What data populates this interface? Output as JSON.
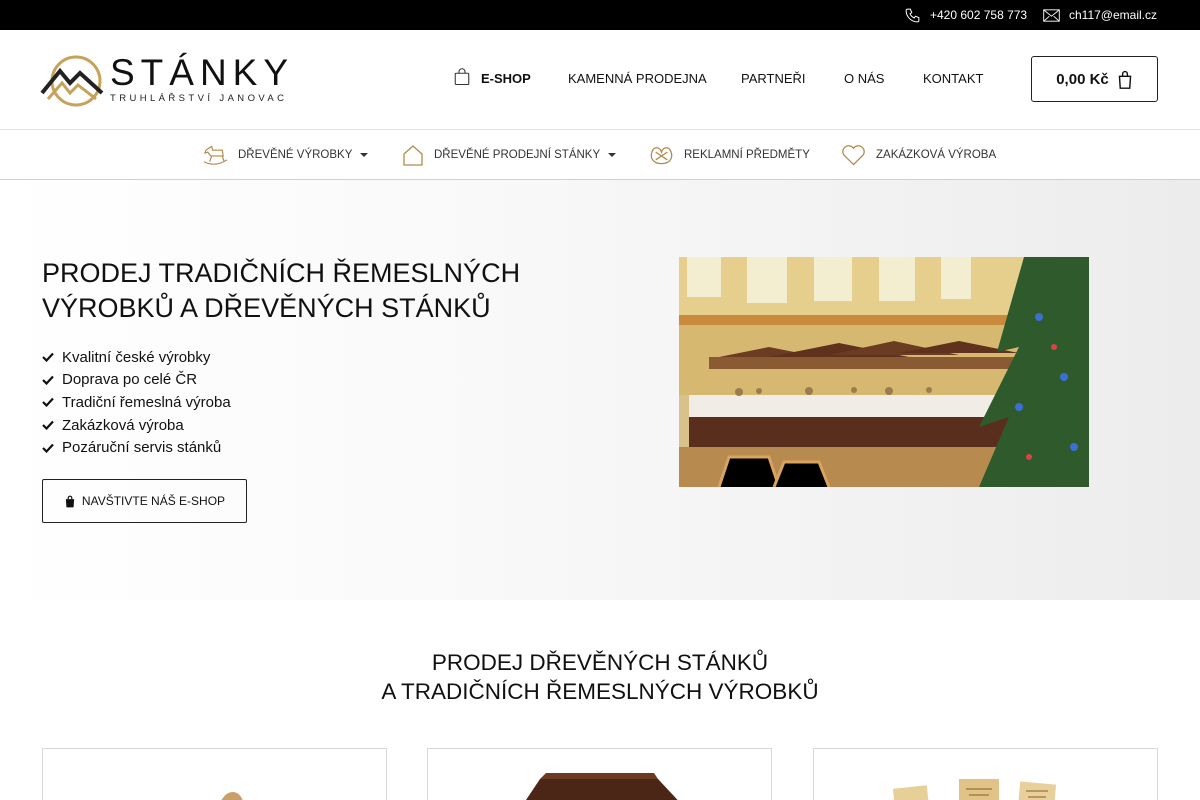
{
  "topbar": {
    "phone": "+420 602 758 773",
    "email": "ch117@email.cz",
    "phone_icon": "phone-icon",
    "email_icon": "envelope-icon"
  },
  "logo": {
    "wordmark": "STÁNKY",
    "tagline": "TRUHLÁŘSTVÍ JANOVAC",
    "colors": {
      "gold": "#c8a15a",
      "dark": "#222222"
    }
  },
  "main_nav": {
    "items": [
      {
        "label": "E-SHOP",
        "icon": "shopping-bag-icon"
      },
      {
        "label": "KAMENNÁ PRODEJNA"
      },
      {
        "label": "PARTNEŘI"
      },
      {
        "label": "O NÁS"
      },
      {
        "label": "KONTAKT"
      }
    ]
  },
  "cart": {
    "total": "0,00 Kč",
    "icon": "shopping-bag-icon"
  },
  "sub_nav": {
    "items": [
      {
        "label": "DŘEVĚNÉ VÝROBKY",
        "icon": "rocking-horse-icon",
        "has_dropdown": true
      },
      {
        "label": "DŘEVĚNÉ PRODEJNÍ STÁNKY",
        "icon": "house-icon",
        "has_dropdown": true
      },
      {
        "label": "REKLAMNÍ PŘEDMĚTY",
        "icon": "pretzel-icon",
        "has_dropdown": false
      },
      {
        "label": "ZAKÁZKOVÁ VÝROBA",
        "icon": "heart-icon",
        "has_dropdown": false
      }
    ]
  },
  "hero": {
    "title_line1": "PRODEJ TRADIČNÍCH ŘEMESLNÝCH",
    "title_line2": "VÝROBKŮ A DŘEVĚNÝCH STÁNKŮ",
    "features": [
      "Kvalitní české výrobky",
      "Doprava po celé ČR",
      "Tradiční řemeslná výroba",
      "Zakázková výroba",
      "Pozáruční servis stánků"
    ],
    "cta_label": "NAVŠTIVTE NÁŠ E-SHOP",
    "cta_icon": "shopping-bag-icon",
    "photo": "market-hall-with-wooden-stalls-and-christmas-tree-photo"
  },
  "section2": {
    "title_line1": "PRODEJ DŘEVĚNÝCH STÁNKŮ",
    "title_line2": "A TRADIČNÍCH ŘEMESLNÝCH VÝROBKŮ",
    "cards": [
      {
        "image": "wooden-toy-product-photo"
      },
      {
        "image": "wooden-market-stall-product-photo"
      },
      {
        "image": "engraved-wooden-boards-product-photo"
      }
    ]
  },
  "colors": {
    "topbar_bg": "#000000",
    "text": "#111111",
    "border": "#222222",
    "logo_gold": "#c8a15a"
  }
}
